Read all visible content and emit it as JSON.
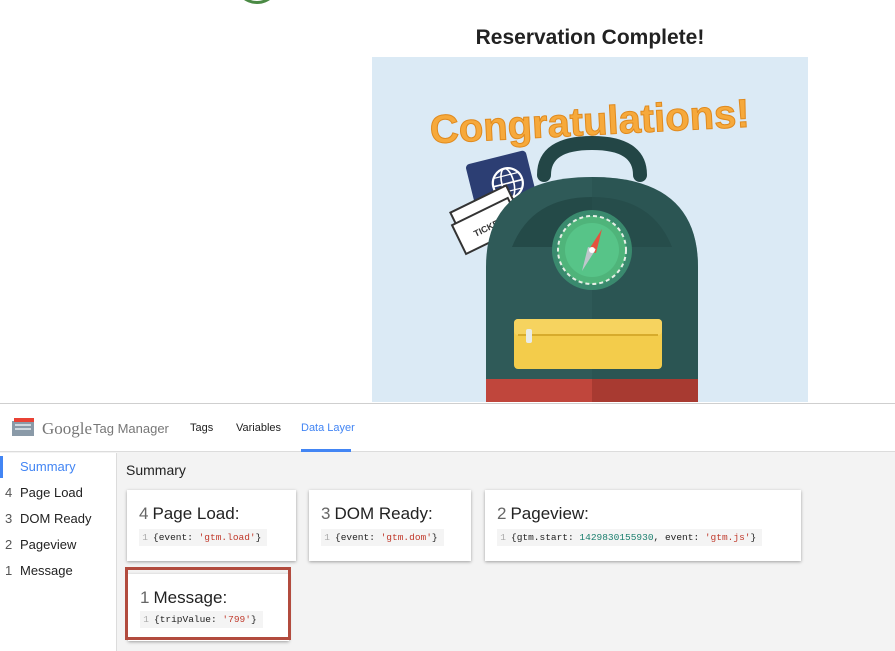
{
  "page": {
    "title": "Reservation Complete!",
    "hero_text": "Congratulations!",
    "ticket_text": "TICKET"
  },
  "gtm": {
    "brand_google": "Google",
    "brand_product": "Tag Manager",
    "tabs": [
      {
        "label": "Tags",
        "active": false
      },
      {
        "label": "Variables",
        "active": false
      },
      {
        "label": "Data Layer",
        "active": true
      }
    ],
    "sidebar": [
      {
        "num": "",
        "label": "Summary",
        "active": true
      },
      {
        "num": "4",
        "label": "Page Load",
        "active": false
      },
      {
        "num": "3",
        "label": "DOM Ready",
        "active": false
      },
      {
        "num": "2",
        "label": "Pageview",
        "active": false
      },
      {
        "num": "1",
        "label": "Message",
        "active": false
      }
    ],
    "main_title": "Summary",
    "cards": [
      {
        "count": "4",
        "title": "Page Load:",
        "line": "1",
        "code_open": "{event: ",
        "code_str": "'gtm.load'",
        "code_close": "}"
      },
      {
        "count": "3",
        "title": "DOM Ready:",
        "line": "1",
        "code_open": "{event: ",
        "code_str": "'gtm.dom'",
        "code_close": "}"
      },
      {
        "count": "2",
        "title": "Pageview:",
        "line": "1",
        "code_open": "{gtm.start: ",
        "code_num": "1429830155930",
        "code_mid": ", event: ",
        "code_str": "'gtm.js'",
        "code_close": "}"
      },
      {
        "count": "1",
        "title": "Message:",
        "line": "1",
        "code_open": "{tripValue: ",
        "code_str": "'799'",
        "code_close": "}"
      }
    ]
  },
  "colors": {
    "accent_blue": "#4285f4",
    "highlight_border": "#b24b3e",
    "code_string": "#c0392b",
    "code_number": "#1a7f6e"
  }
}
